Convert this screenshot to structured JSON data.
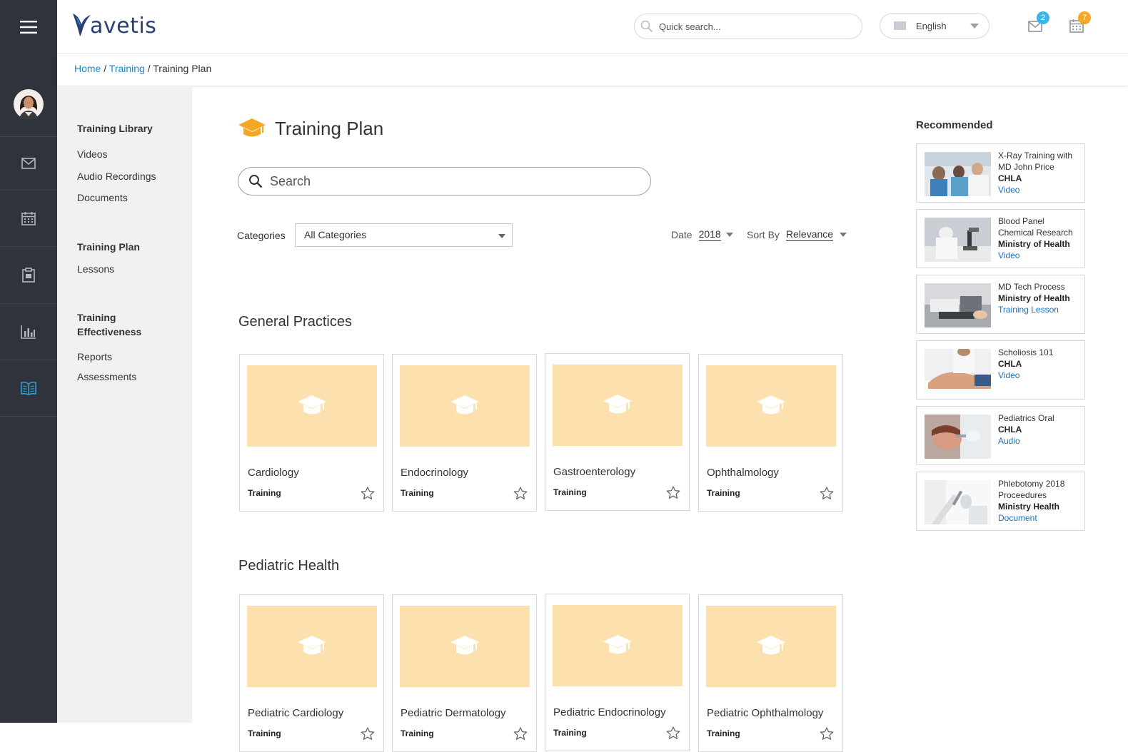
{
  "app": {
    "logo_text": "avetis",
    "colors": {
      "accent": "#1e88c8",
      "rail": "#2f333b",
      "thumb": "#fce0ad",
      "badge_mail": "#3bb5e3",
      "badge_cal": "#f5a623"
    }
  },
  "rail": {
    "items": [
      {
        "name": "menu",
        "icon": "hamburger-icon"
      },
      {
        "name": "avatar",
        "icon": "avatar"
      },
      {
        "name": "mail",
        "icon": "mail-icon"
      },
      {
        "name": "calendar",
        "icon": "calendar-icon"
      },
      {
        "name": "clipboard",
        "icon": "clipboard-icon"
      },
      {
        "name": "reports",
        "icon": "bar-chart-icon"
      },
      {
        "name": "training",
        "icon": "book-icon",
        "active": true
      }
    ]
  },
  "header": {
    "search_placeholder": "Quick search...",
    "language": "English",
    "mail_count": "2",
    "calendar_count": "7"
  },
  "breadcrumb": {
    "home": "Home",
    "separator": "/",
    "training": "Training",
    "current": "Training Plan"
  },
  "subnav": {
    "groups": [
      {
        "title": "Training Library",
        "items": [
          "Videos",
          "Audio Recordings",
          "Documents"
        ]
      },
      {
        "title": "Training Plan",
        "items": [
          "Lessons"
        ]
      },
      {
        "title": "Training Effectiveness",
        "items": [
          "Reports",
          "Assessments"
        ]
      }
    ]
  },
  "main": {
    "title": "Training Plan",
    "search_placeholder": "Search",
    "categories_label": "Categories",
    "categories_value": "All Categories",
    "date_label": "Date",
    "date_value": "2018",
    "sort_label": "Sort By",
    "sort_value": "Relevance",
    "sections": [
      {
        "title": "General Practices",
        "cards": [
          {
            "name": "Cardiology",
            "kind": "Training"
          },
          {
            "name": "Endocrinology",
            "kind": "Training"
          },
          {
            "name": "Gastroenterology",
            "kind": "Training"
          },
          {
            "name": "Ophthalmology",
            "kind": "Training"
          }
        ]
      },
      {
        "title": "Pediatric Health",
        "cards": [
          {
            "name": "Pediatric Cardiology",
            "kind": "Training"
          },
          {
            "name": "Pediatric Dermatology",
            "kind": "Training"
          },
          {
            "name": "Pediatric Endocrinology",
            "kind": "Training"
          },
          {
            "name": "Pediatric Ophthalmology",
            "kind": "Training"
          }
        ]
      }
    ]
  },
  "recommended": {
    "title": "Recommended",
    "items": [
      {
        "title": "X-Ray Training with MD John Price",
        "org": "CHLA",
        "type": "Video",
        "photo": "doctors-group"
      },
      {
        "title": "Blood Panel Chemical Research",
        "org": "Ministry of Health",
        "type": "Video",
        "photo": "lab-microscope"
      },
      {
        "title": "MD Tech Process",
        "org": "Ministry of Health",
        "type": "Training Lesson",
        "photo": "lab-equipment"
      },
      {
        "title": "Scholiosis 101",
        "org": "CHLA",
        "type": "Video",
        "photo": "back-exam"
      },
      {
        "title": "Pediatrics Oral",
        "org": "CHLA",
        "type": "Audio",
        "photo": "dental-exam"
      },
      {
        "title": "Phlebotomy 2018 Proceedures",
        "org": "Ministry Health",
        "type": "Document",
        "photo": "blood-draw"
      }
    ]
  }
}
